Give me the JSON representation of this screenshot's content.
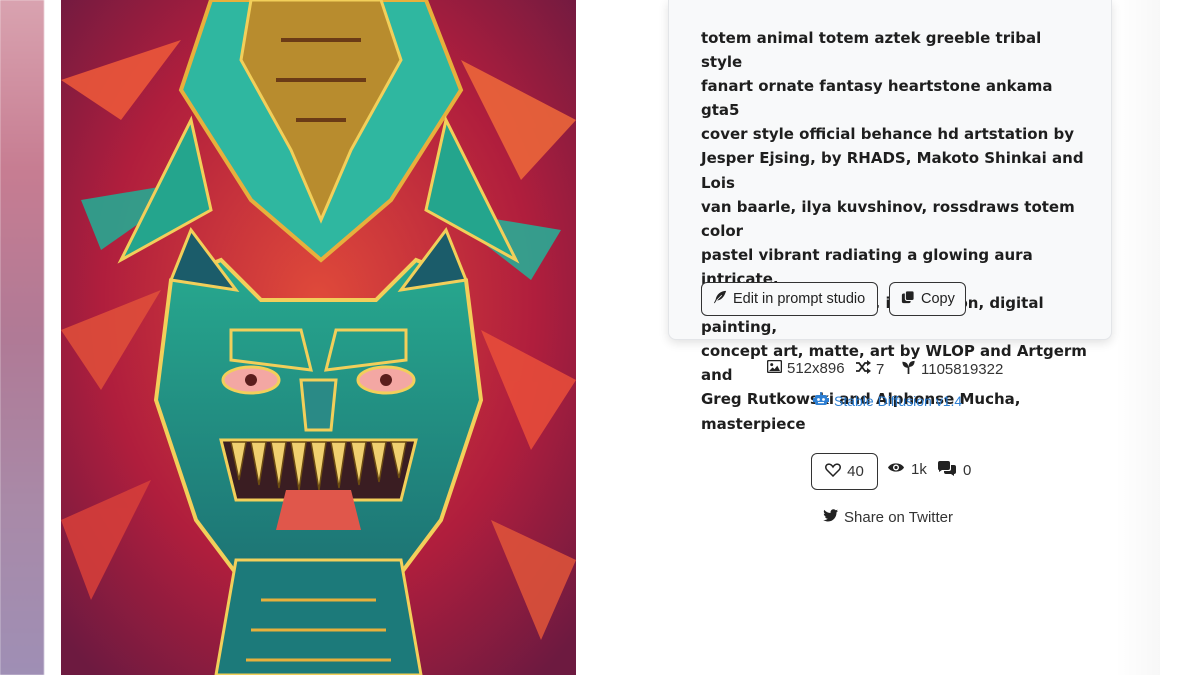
{
  "prompt": {
    "text": "totem animal totem aztek greeble tribal style fanart ornate fantasy heartstone ankama gta5 cover style official behance hd artstation by Jesper Ejsing, by RHADS, Makoto Shinkai and Lois van baarle, ilya kuvshinov, rossdraws totem color pastel vibrant radiating a glowing aura intricate, elegant, sharp focus, illustration, digital painting, concept art, matte, art by WLOP and Artgerm and Greg Rutkowski and Alphonse Mucha, masterpiece",
    "lines": [
      "totem animal totem aztek greeble tribal style",
      "fanart ornate fantasy heartstone ankama gta5",
      "cover style official behance hd artstation by",
      "Jesper Ejsing, by RHADS, Makoto Shinkai and Lois",
      "van baarle, ilya kuvshinov, rossdraws totem color",
      "pastel vibrant radiating a glowing aura intricate,",
      "elegant, sharp focus, illustration, digital painting,",
      "concept art, matte, art by WLOP and Artgerm and",
      "Greg Rutkowski and Alphonse Mucha,",
      "masterpiece"
    ]
  },
  "actions": {
    "edit_label": "Edit in prompt studio",
    "copy_label": "Copy"
  },
  "meta": {
    "dimensions": "512x896",
    "steps": "7",
    "seed": "1105819322",
    "model": "Stable Diffusion v1.4"
  },
  "social": {
    "likes": "40",
    "views": "1k",
    "comments": "0",
    "share_label": "Share on Twitter"
  },
  "colors": {
    "link": "#2d7fd3",
    "card_bg": "#f8f9fa",
    "art_red": "#b0213a",
    "art_teal": "#2fb7a0"
  },
  "icons": {
    "edit": "feather-icon",
    "copy": "copy-icon",
    "dimensions": "image-icon",
    "steps": "shuffle-icon",
    "seed": "seedling-icon",
    "model": "robot-icon",
    "like": "heart-icon",
    "views": "eye-icon",
    "comments": "comments-icon",
    "share": "twitter-icon"
  }
}
